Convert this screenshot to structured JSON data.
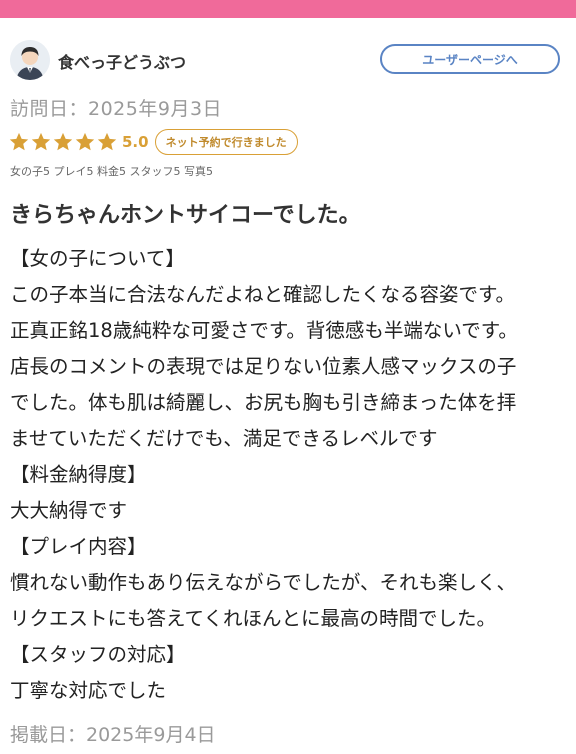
{
  "reviewer": {
    "name": "食べっ子どうぶつ",
    "user_page_label": "ユーザーページへ"
  },
  "visit_date": "訪問日：2025年9月3日",
  "rating": {
    "stars": 5,
    "score": "5.0",
    "badge": "ネット予約で行きました",
    "sub_scores": "女の子5 プレイ5 料金5 スタッフ5 写真5"
  },
  "review": {
    "title": "きらちゃんホントサイコーでした。",
    "lines": [
      "【女の子について】",
      "この子本当に合法なんだよねと確認したくなる容姿です。",
      "正真正銘18歳純粋な可愛さです。背徳感も半端ないです。",
      "店長のコメントの表現では足りない位素人感マックスの子",
      "でした。体も肌は綺麗し、お尻も胸も引き締まった体を拝",
      "ませていただくだけでも、満足できるレベルです",
      "【料金納得度】",
      "大大納得です",
      "【プレイ内容】",
      "慣れない動作もあり伝えながらでしたが、それも楽しく、",
      "リクエストにも答えてくれほんとに最高の時間でした。",
      "【スタッフの対応】",
      "丁寧な対応でした"
    ]
  },
  "posted_date": "掲載日：2025年9月4日",
  "colors": {
    "accent_pink": "#f06a9a",
    "button_blue": "#5a84c4",
    "star_gold": "#d9a036"
  }
}
